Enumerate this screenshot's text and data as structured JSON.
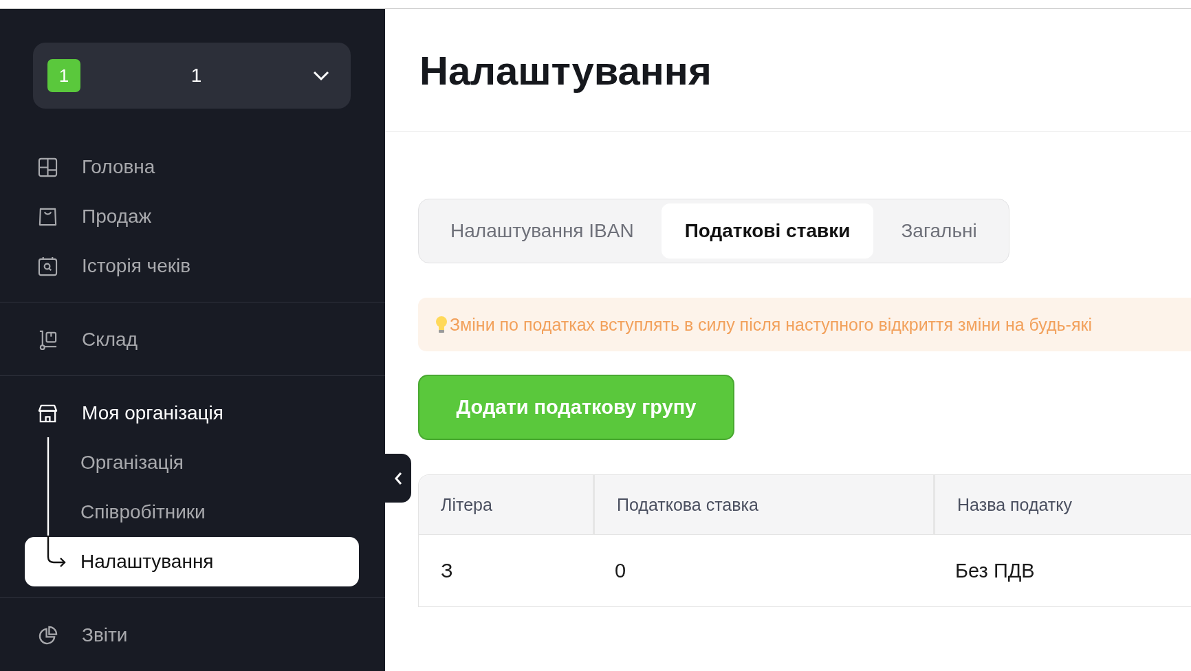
{
  "org_selector": {
    "badge": "1",
    "name": "1"
  },
  "nav_sections": [
    {
      "items": [
        {
          "label": "Головна",
          "selected": false,
          "expanded": false
        },
        {
          "label": "Продаж",
          "selected": false,
          "expanded": false
        },
        {
          "label": "Історія чеків",
          "selected": false,
          "expanded": false
        }
      ]
    },
    {
      "items": [
        {
          "label": "Склад",
          "selected": false,
          "expanded": false
        }
      ]
    },
    {
      "items": [
        {
          "label": "Моя організація",
          "selected": false,
          "expanded": true,
          "children": [
            {
              "label": "Організація",
              "selected": false
            },
            {
              "label": "Співробітники",
              "selected": false
            },
            {
              "label": "Налаштування",
              "selected": true
            }
          ]
        }
      ]
    },
    {
      "items": [
        {
          "label": "Звіти",
          "selected": false,
          "expanded": false
        }
      ]
    }
  ],
  "page_title": "Налаштування",
  "tabs": [
    {
      "label": "Налаштування IBAN",
      "selected": false
    },
    {
      "label": "Податкові ставки",
      "selected": true
    },
    {
      "label": "Загальні",
      "selected": false
    }
  ],
  "notice": "Зміни по податках вступлять в силу після наступного відкриття зміни на будь-які",
  "add_button": "Додати податкову групу",
  "table": {
    "columns": [
      "Літера",
      "Податкова ставка",
      "Назва податку"
    ],
    "rows": [
      [
        "З",
        "0",
        "Без ПДВ"
      ]
    ]
  }
}
